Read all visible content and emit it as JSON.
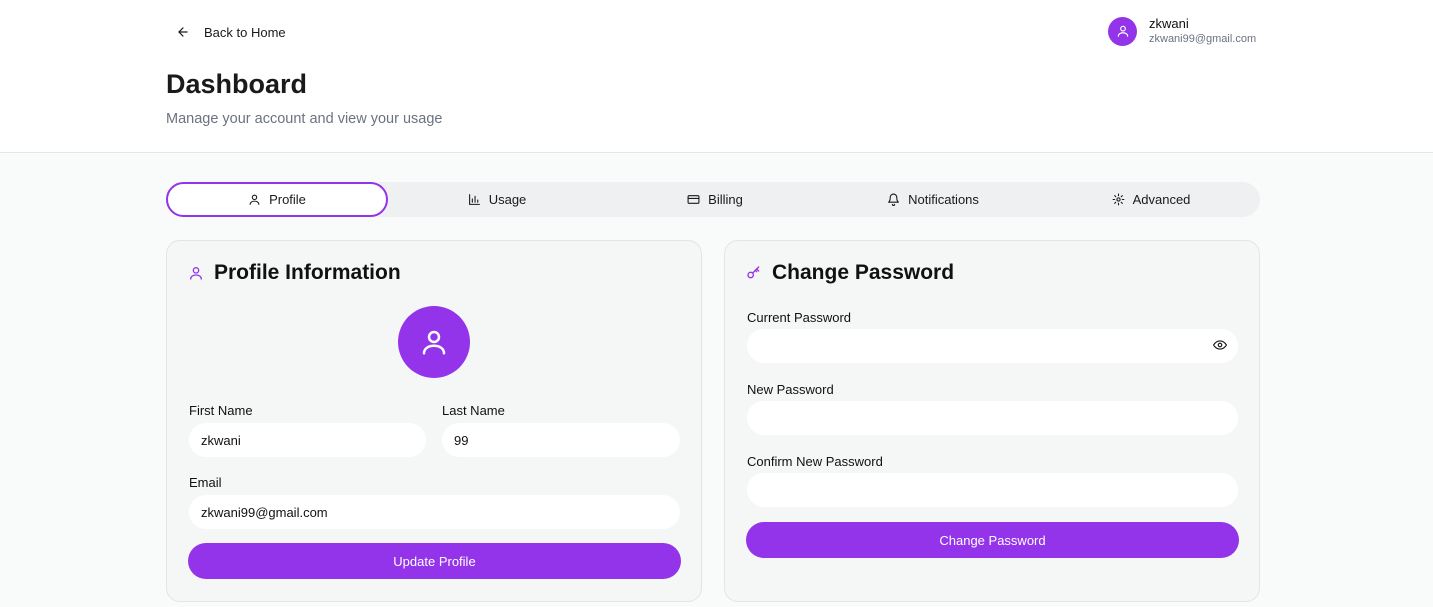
{
  "header": {
    "back_label": "Back to Home",
    "title": "Dashboard",
    "subtitle": "Manage your account and view your usage"
  },
  "user": {
    "name": "zkwani",
    "email": "zkwani99@gmail.com"
  },
  "tabs": [
    {
      "label": "Profile",
      "icon": "user-icon",
      "active": true
    },
    {
      "label": "Usage",
      "icon": "bar-chart-icon",
      "active": false
    },
    {
      "label": "Billing",
      "icon": "credit-card-icon",
      "active": false
    },
    {
      "label": "Notifications",
      "icon": "bell-icon",
      "active": false
    },
    {
      "label": "Advanced",
      "icon": "gear-icon",
      "active": false
    }
  ],
  "profile": {
    "title": "Profile Information",
    "first_name_label": "First Name",
    "first_name_value": "zkwani",
    "last_name_label": "Last Name",
    "last_name_value": "99",
    "email_label": "Email",
    "email_value": "zkwani99@gmail.com",
    "update_label": "Update Profile"
  },
  "password": {
    "title": "Change Password",
    "current_label": "Current Password",
    "new_label": "New Password",
    "confirm_label": "Confirm New Password",
    "button_label": "Change Password"
  },
  "colors": {
    "accent": "#9333ea",
    "background": "#f9fafa",
    "card": "#f5f6f6"
  }
}
